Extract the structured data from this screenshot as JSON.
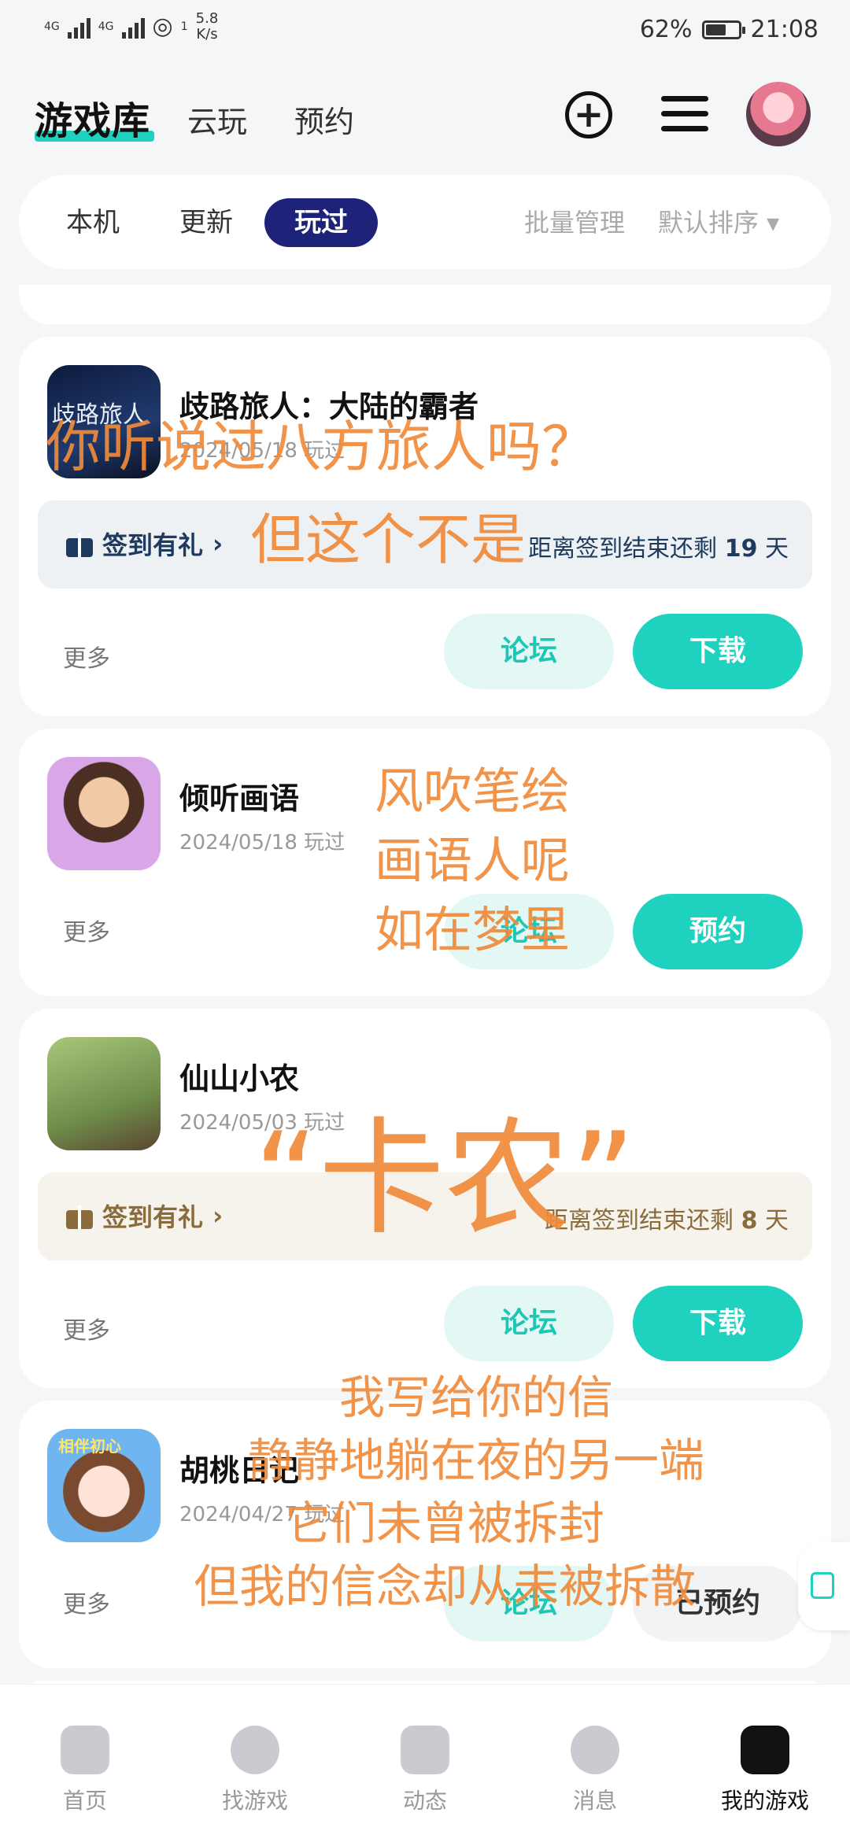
{
  "status_bar": {
    "net1": "4G",
    "net2": "4G",
    "wifi_badge": "1",
    "speed_value": "5.8",
    "speed_unit": "K/s",
    "battery": "62%",
    "time": "21:08"
  },
  "header": {
    "title": "游戏库",
    "tabs": [
      "云玩",
      "预约"
    ]
  },
  "filter": {
    "tabs": [
      "本机",
      "更新",
      "玩过"
    ],
    "active": "玩过",
    "batch": "批量管理",
    "sort": "默认排序 ▾"
  },
  "games": [
    {
      "name": "歧路旅人：大陆的霸者",
      "date": "2024/05/18 玩过",
      "icon_text": "歧路旅人",
      "gift_label": "签到有礼",
      "gift_arrow": "›",
      "gift_pre": "距离签到结束还剩",
      "gift_days": "19",
      "gift_unit": "天",
      "more": "更多",
      "forum": "论坛",
      "action": "下载"
    },
    {
      "name": "倾听画语",
      "date": "2024/05/18 玩过",
      "more": "更多",
      "forum": "论坛",
      "action": "预约"
    },
    {
      "name": "仙山小农",
      "date": "2024/05/03 玩过",
      "gift_label": "签到有礼",
      "gift_arrow": "›",
      "gift_pre": "距离签到结束还剩",
      "gift_days": "8",
      "gift_unit": "天",
      "more": "更多",
      "forum": "论坛",
      "action": "下载"
    },
    {
      "name": "胡桃日记",
      "date": "2024/04/27 玩过",
      "icon_text": "相伴初心",
      "more": "更多",
      "forum": "论坛",
      "action": "已预约"
    }
  ],
  "overlay": {
    "l1": "你听说过八方旅人吗？",
    "l2": "但这个不是",
    "poem": [
      "风吹笔绘",
      "画语人呢",
      "如在梦里"
    ],
    "kanong": "“卡农”",
    "letter": [
      "我写给你的信",
      "静静地躺在夜的另一端",
      "它们未曾被拆封",
      "但我的信念却从未被拆散"
    ],
    "color": "#f08a3a"
  },
  "nav": {
    "items": [
      "首页",
      "找游戏",
      "动态",
      "消息",
      "我的游戏"
    ],
    "active_index": 4
  },
  "colors": {
    "accent": "#1fd1bf",
    "active_tab": "#1e2279",
    "background": "#f5f6f8"
  }
}
